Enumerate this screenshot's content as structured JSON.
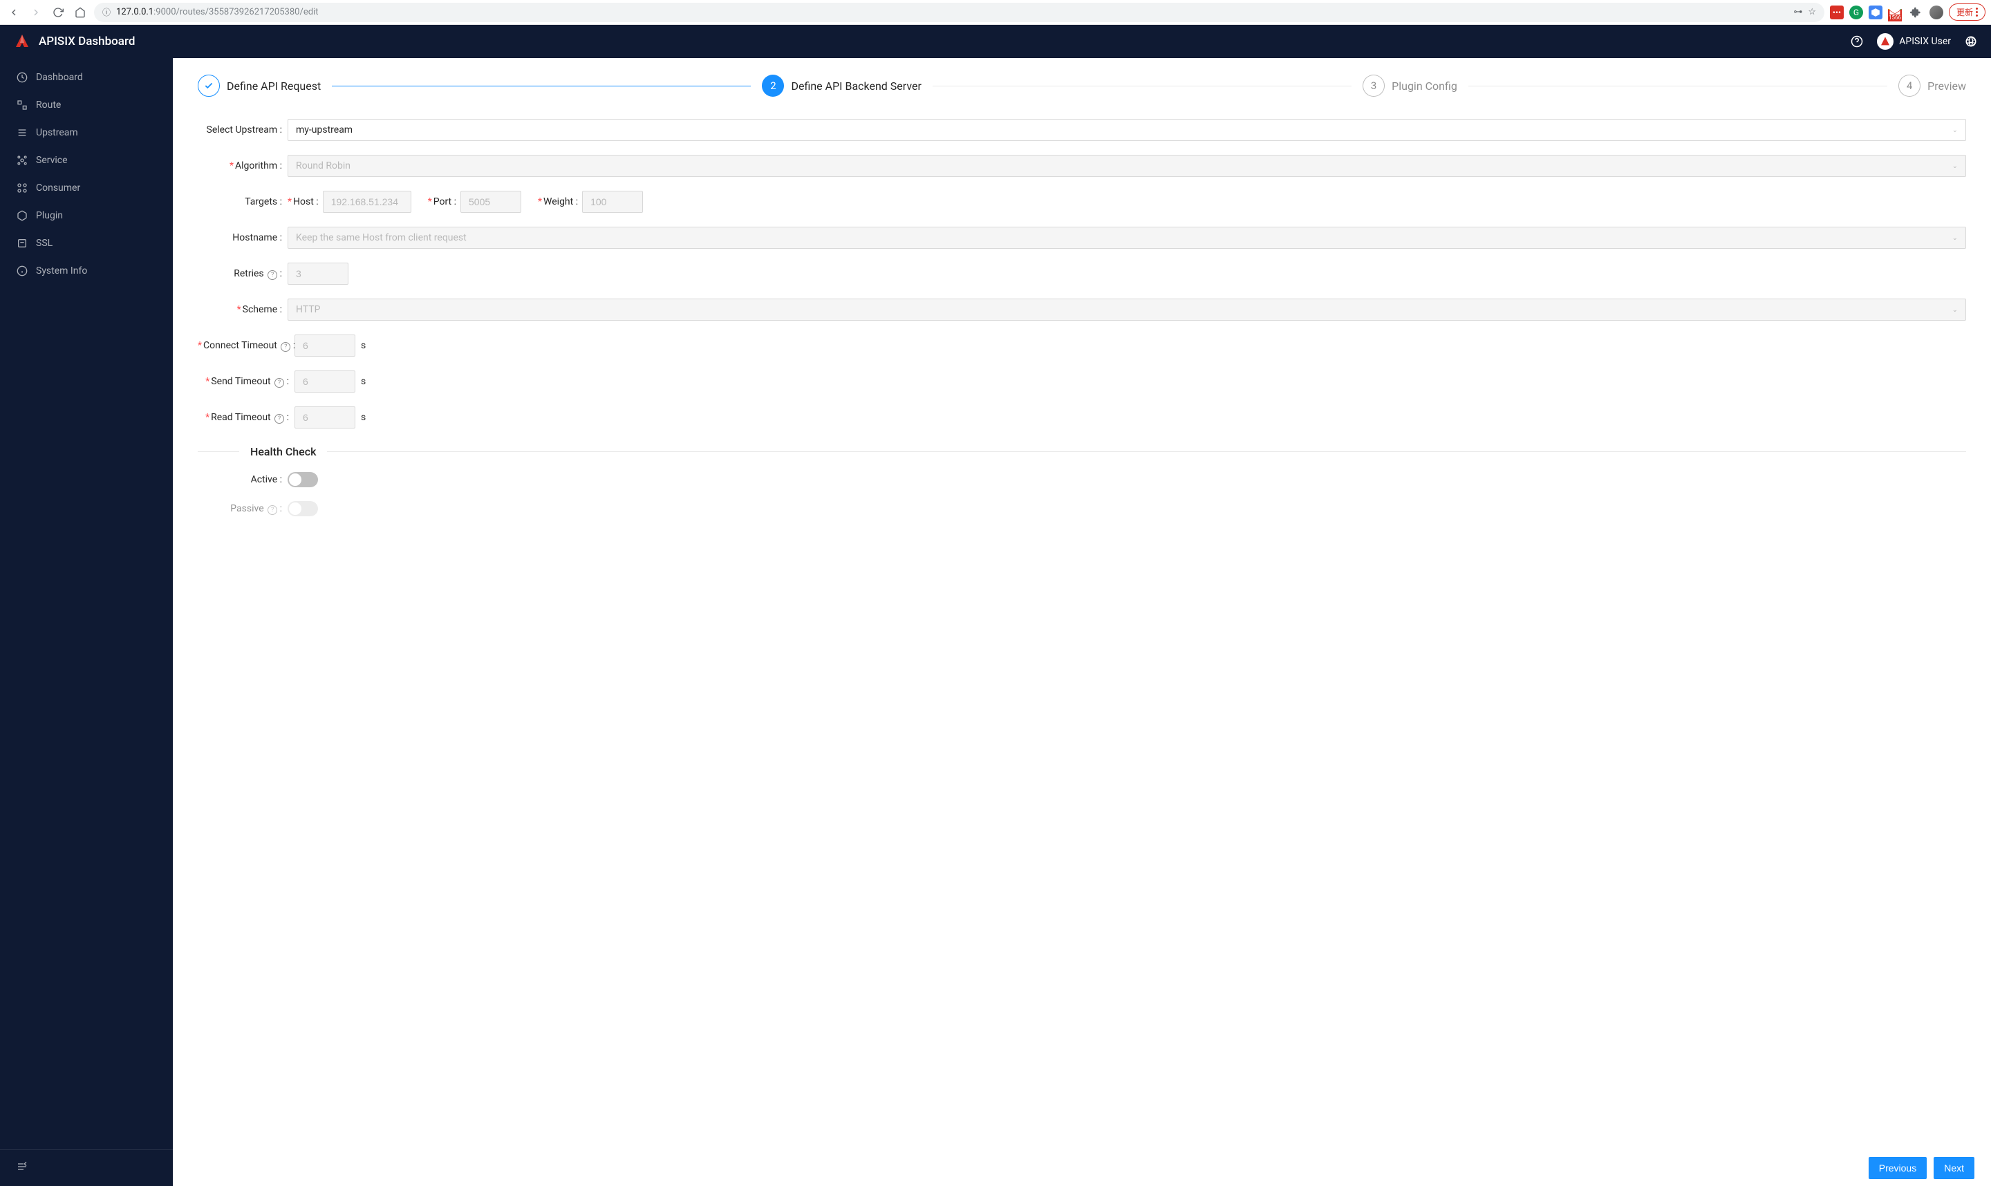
{
  "browser": {
    "url_host": "127.0.0.1",
    "url_path": ":9000/routes/355873926217205380/edit",
    "gmail_badge": "1566",
    "update_label": "更新"
  },
  "header": {
    "title": "APISIX Dashboard",
    "user": "APISIX User"
  },
  "sidebar": {
    "items": [
      {
        "label": "Dashboard"
      },
      {
        "label": "Route"
      },
      {
        "label": "Upstream"
      },
      {
        "label": "Service"
      },
      {
        "label": "Consumer"
      },
      {
        "label": "Plugin"
      },
      {
        "label": "SSL"
      },
      {
        "label": "System Info"
      }
    ]
  },
  "steps": [
    {
      "title": "Define API Request"
    },
    {
      "title": "Define API Backend Server"
    },
    {
      "title": "Plugin Config"
    },
    {
      "title": "Preview"
    }
  ],
  "form": {
    "select_upstream_label": "Select Upstream",
    "select_upstream_value": "my-upstream",
    "algorithm_label": "Algorithm",
    "algorithm_value": "Round Robin",
    "targets_label": "Targets",
    "host_label": "Host",
    "host_placeholder": "192.168.51.234",
    "port_label": "Port",
    "port_placeholder": "5005",
    "weight_label": "Weight",
    "weight_placeholder": "100",
    "hostname_label": "Hostname",
    "hostname_value": "Keep the same Host from client request",
    "retries_label": "Retries",
    "retries_placeholder": "3",
    "scheme_label": "Scheme",
    "scheme_value": "HTTP",
    "connect_timeout_label": "Connect Timeout",
    "connect_timeout_placeholder": "6",
    "send_timeout_label": "Send Timeout",
    "send_timeout_placeholder": "6",
    "read_timeout_label": "Read Timeout",
    "read_timeout_placeholder": "6",
    "unit_s": "s",
    "health_check_title": "Health Check",
    "active_label": "Active",
    "passive_label": "Passive"
  },
  "footer": {
    "previous": "Previous",
    "next": "Next"
  }
}
